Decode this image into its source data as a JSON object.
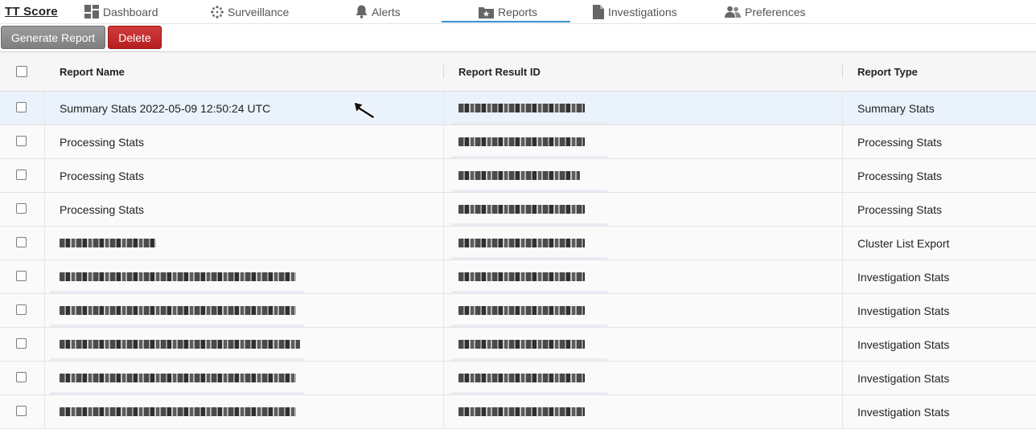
{
  "app": {
    "brand": "TT Score"
  },
  "nav": {
    "items": [
      {
        "label": "Dashboard",
        "icon": "dashboard-icon"
      },
      {
        "label": "Surveillance",
        "icon": "surveillance-icon"
      },
      {
        "label": "Alerts",
        "icon": "bell-icon"
      },
      {
        "label": "Reports",
        "icon": "reports-icon",
        "active": true
      },
      {
        "label": "Investigations",
        "icon": "document-icon"
      },
      {
        "label": "Preferences",
        "icon": "users-icon"
      }
    ],
    "active_color": "#3a8fd0"
  },
  "toolbar": {
    "generate_label": "Generate Report",
    "delete_label": "Delete",
    "delete_color": "#c62828"
  },
  "table": {
    "columns": [
      "Report Name",
      "Report Result ID",
      "Report Type"
    ],
    "rows": [
      {
        "name": "Summary Stats 2022-05-09 12:50:24 UTC",
        "type": "Summary Stats",
        "selected": true
      },
      {
        "name": "Processing Stats",
        "type": "Processing Stats"
      },
      {
        "name": "Processing Stats",
        "type": "Processing Stats"
      },
      {
        "name": "Processing Stats",
        "type": "Processing Stats"
      },
      {
        "name": "",
        "type": "Cluster List Export"
      },
      {
        "name": "",
        "type": "Investigation Stats"
      },
      {
        "name": "",
        "type": "Investigation Stats"
      },
      {
        "name": "",
        "type": "Investigation Stats"
      },
      {
        "name": "",
        "type": "Investigation Stats"
      },
      {
        "name": "",
        "type": "Investigation Stats"
      }
    ]
  }
}
